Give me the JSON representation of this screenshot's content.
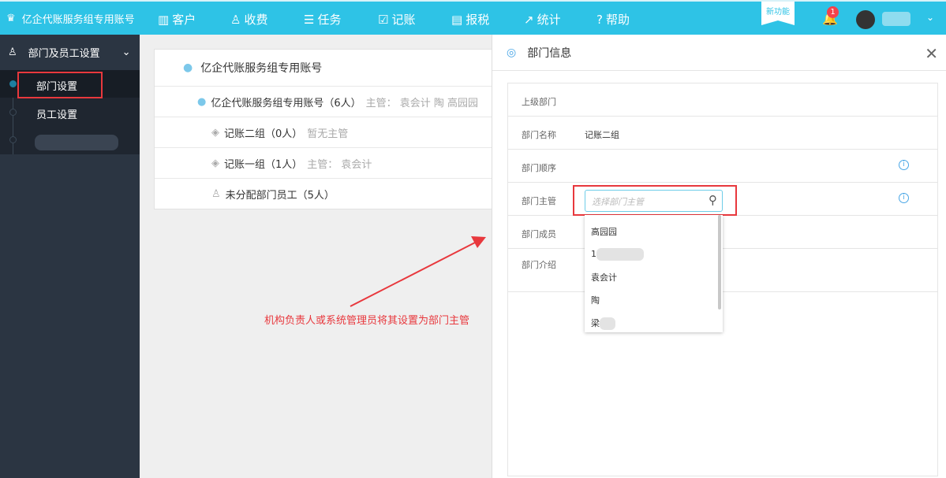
{
  "topbar": {
    "brand": "亿企代账服务组专用账号",
    "nav": [
      {
        "icon": "building-icon",
        "label": "客户"
      },
      {
        "icon": "stamp-icon",
        "label": "收费"
      },
      {
        "icon": "list-icon",
        "label": "任务"
      },
      {
        "icon": "edit-icon",
        "label": "记账"
      },
      {
        "icon": "coins-icon",
        "label": "报税"
      },
      {
        "icon": "chart-icon",
        "label": "统计"
      },
      {
        "icon": "help-icon",
        "label": "帮助"
      }
    ],
    "new_feature": "新功能",
    "notifications": "1",
    "color": "#2ec3e6"
  },
  "sidebar": {
    "group": "部门及员工设置",
    "items": [
      {
        "label": "部门设置",
        "active": true
      },
      {
        "label": "员工设置"
      }
    ]
  },
  "tree": {
    "title": "亿企代账服务组专用账号",
    "rows": [
      {
        "name": "亿企代账服务组专用账号（6人）",
        "extra": "主管：  袁会计  陶  高园园"
      },
      {
        "name": "记账二组（0人）",
        "extra": "暂无主管"
      },
      {
        "name": "记账一组（1人）",
        "extra": "主管：  袁会计"
      },
      {
        "name": "未分配部门员工（5人）",
        "extra": ""
      }
    ]
  },
  "panel": {
    "title": "部门信息",
    "fields": [
      {
        "label": "上级部门",
        "value": ""
      },
      {
        "label": "部门名称",
        "value": "记账二组"
      },
      {
        "label": "部门顺序",
        "value": ""
      },
      {
        "label": "部门主管",
        "value": ""
      },
      {
        "label": "部门成员",
        "value": ""
      },
      {
        "label": "部门介绍",
        "value": ""
      }
    ],
    "manager_placeholder": "选择部门主管",
    "options": [
      "高园园",
      "1",
      "袁会计",
      "陶",
      "梁"
    ]
  },
  "annotation": "机构负责人或系统管理员将其设置为部门主管"
}
